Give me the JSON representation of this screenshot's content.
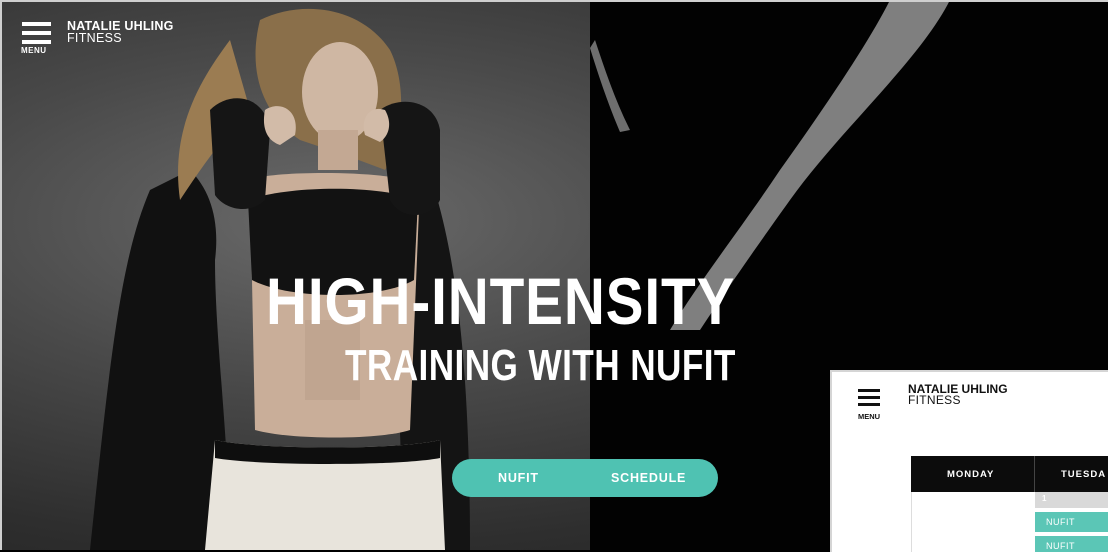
{
  "header": {
    "menu_label": "MENU",
    "brand_line1": "NATALIE UHLING",
    "brand_line2": "FITNESS"
  },
  "hero": {
    "headline_line1": "HIGH-INTENSITY",
    "headline_line2": "TRAINING WITH NUFIT"
  },
  "cta": {
    "nufit_label": "NUFIT",
    "schedule_label": "SCHEDULE"
  },
  "inset": {
    "menu_label": "MENU",
    "brand_line1": "NATALIE UHLING",
    "brand_line2": "FITNESS",
    "schedule": {
      "columns": [
        "MONDAY",
        "TUESDA"
      ],
      "day_number": "1",
      "slots": [
        "NUFIT",
        "NUFIT"
      ]
    }
  },
  "colors": {
    "accent": "#4fc2b2",
    "background_dark": "#020202",
    "text_light": "#ffffff"
  },
  "icons": [
    "menu-icon"
  ]
}
